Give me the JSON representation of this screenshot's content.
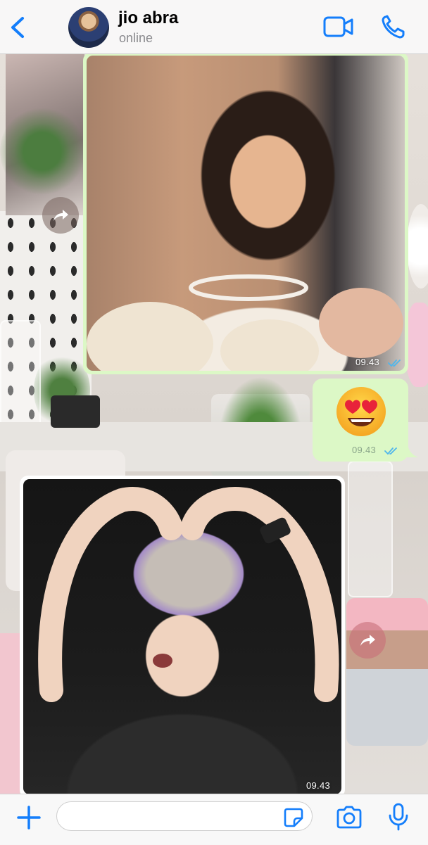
{
  "header": {
    "contact_name": "jio abra",
    "contact_status": "online",
    "icons": {
      "back": "chevron-left-icon",
      "video": "video-camera-icon",
      "call": "phone-icon"
    }
  },
  "messages": [
    {
      "type": "image",
      "direction": "outgoing",
      "description_icon": "photo",
      "time": "09.43",
      "read": true
    },
    {
      "type": "emoji",
      "direction": "outgoing",
      "emoji": "😍",
      "time": "09.43",
      "read": true
    },
    {
      "type": "image",
      "direction": "incoming",
      "description_icon": "photo",
      "time": "09.43"
    }
  ],
  "composer": {
    "placeholder": "",
    "value": "",
    "icons": {
      "attach": "plus-icon",
      "sticker": "sticker-icon",
      "camera": "camera-icon",
      "mic": "microphone-icon"
    }
  },
  "colors": {
    "accent": "#147efb",
    "outgoing_bubble": "#dcf8c6",
    "incoming_bubble": "#ffffff",
    "read_ticks": "#4fb6ec"
  }
}
